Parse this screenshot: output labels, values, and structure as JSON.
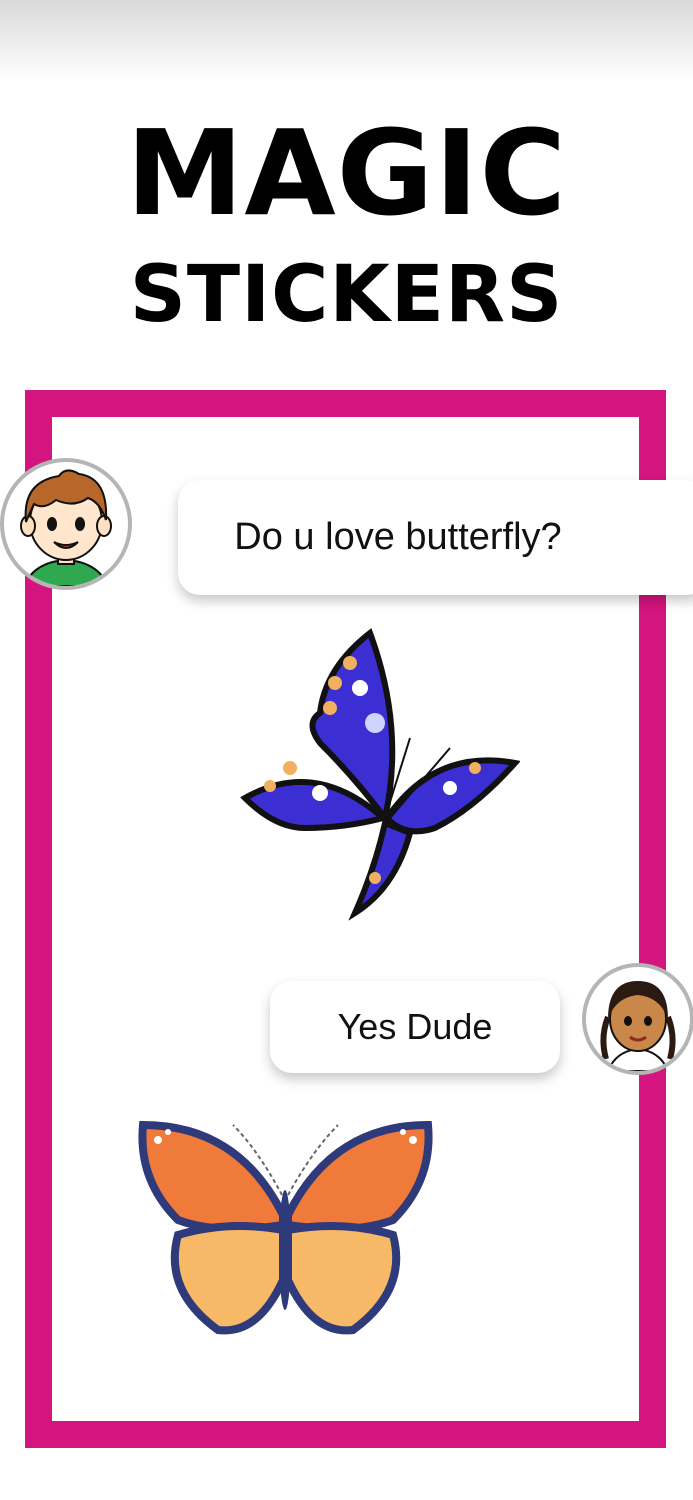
{
  "title": {
    "line1": "MAGIC",
    "line2": "STICKERS"
  },
  "colors": {
    "frame": "#d4147f",
    "bubble_bg": "#ffffff",
    "avatar_border": "#b5b5b5"
  },
  "chat": [
    {
      "sender": "boy",
      "text": "Do u love butterfly?"
    },
    {
      "sender": "girl",
      "text": "Yes Dude"
    }
  ],
  "stickers": [
    {
      "icon": "blue-butterfly-sticker"
    },
    {
      "icon": "monarch-butterfly-sticker"
    }
  ]
}
